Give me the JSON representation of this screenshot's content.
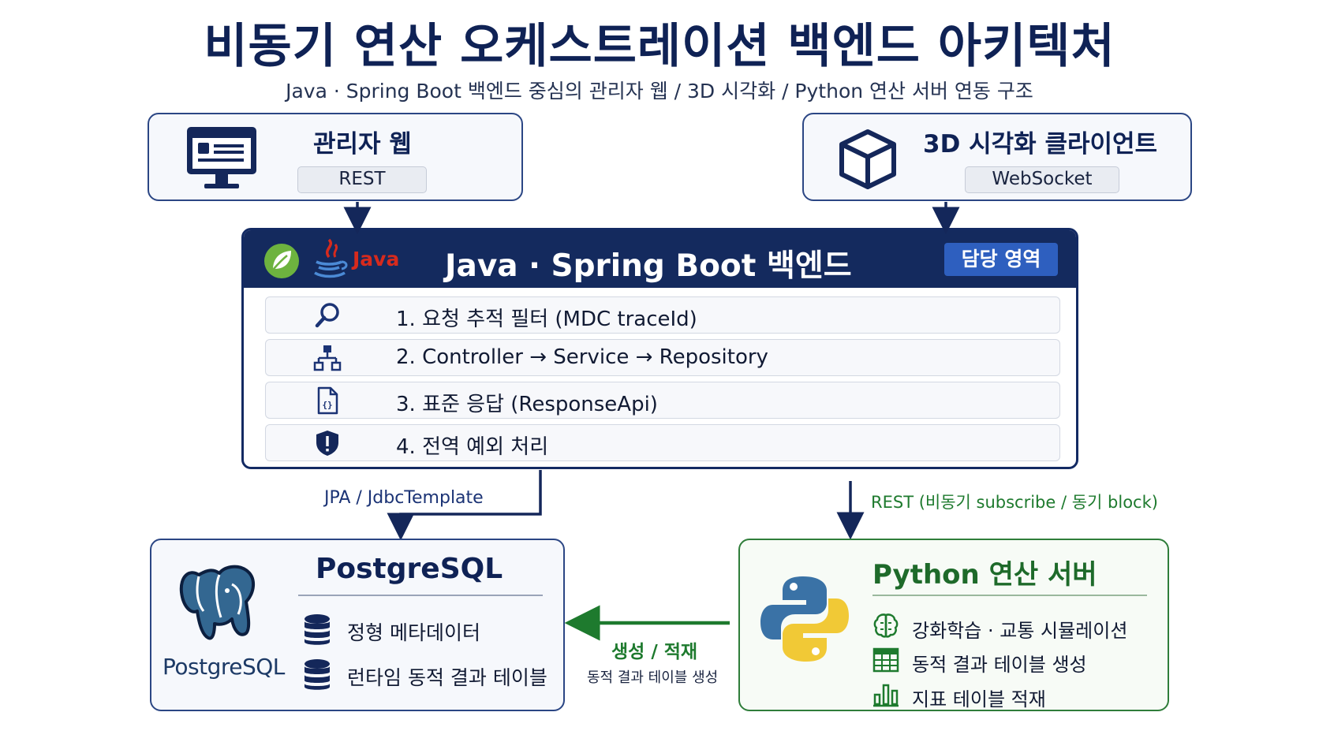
{
  "header": {
    "title": "비동기 연산 오케스트레이션 백엔드 아키텍처",
    "subtitle": "Java · Spring Boot 백엔드 중심의 관리자 웹 / 3D 시각화 / Python 연산 서버 연동 구조"
  },
  "clients": {
    "admin": {
      "title": "관리자 웹",
      "protocol": "REST",
      "icon": "monitor-icon"
    },
    "viz": {
      "title": "3D 시각화 클라이언트",
      "protocol": "WebSocket",
      "icon": "cube-icon"
    }
  },
  "backend": {
    "title": "Java · Spring Boot 백엔드",
    "badge": "담당 영역",
    "java_label": "Java",
    "rows": [
      {
        "text": "1. 요청 추적 필터 (MDC traceId)",
        "icon": "magnifier-icon"
      },
      {
        "text": "2. Controller → Service → Repository",
        "icon": "hierarchy-icon"
      },
      {
        "text": "3. 표준 응답 (ResponseApi)",
        "icon": "json-file-icon"
      },
      {
        "text": "4. 전역 예외 처리",
        "icon": "shield-alert-icon"
      }
    ]
  },
  "connections": {
    "db_label": "JPA / JdbcTemplate",
    "python_label": "REST (비동기 subscribe / 동기 block)",
    "write_label": "생성 / 적재",
    "write_sub": "동적 결과 테이블 생성"
  },
  "postgres": {
    "title": "PostgreSQL",
    "logo_text": "PostgreSQL",
    "items": [
      "정형 메타데이터",
      "런타임 동적 결과 테이블"
    ]
  },
  "python": {
    "title": "Python 연산 서버",
    "items": [
      {
        "text": "강화학습 · 교통 시뮬레이션",
        "icon": "brain-icon"
      },
      {
        "text": "동적 결과 테이블 생성",
        "icon": "table-icon"
      },
      {
        "text": "지표 테이블 적재",
        "icon": "bar-chart-icon"
      }
    ]
  },
  "colors": {
    "navy": "#142a5e",
    "green": "#1e7a2e",
    "blue_badge": "#2e5fbf"
  }
}
